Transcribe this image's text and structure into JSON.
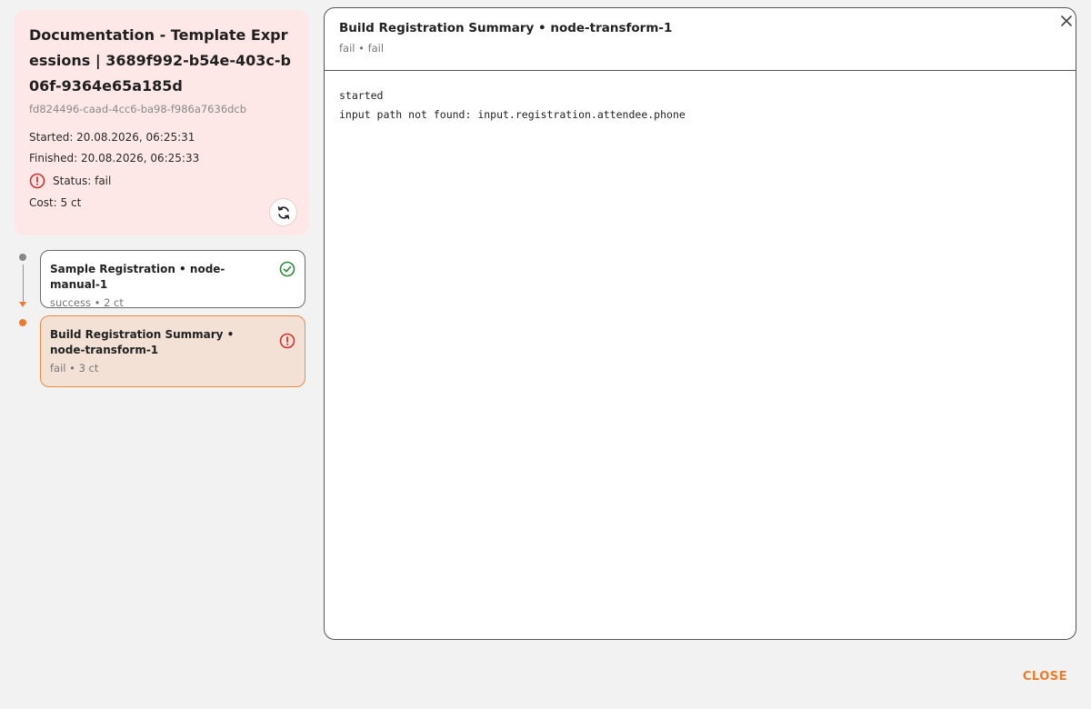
{
  "run": {
    "title": "Documentation - Template Expressions | 3689f992-b54e-403c-b06f-9364e65a185d",
    "id": "fd824496-caad-4cc6-ba98-f986a7636dcb",
    "started": "Started: 20.08.2026, 06:25:31",
    "finished": "Finished: 20.08.2026, 06:25:33",
    "status": "Status: fail",
    "cost": "Cost: 5 ct"
  },
  "nodes": [
    {
      "title": "Sample Registration • node-manual-1",
      "subtitle": "success • 2 ct",
      "status": "success"
    },
    {
      "title": "Build Registration Summary • node-transform-1",
      "subtitle": "fail • 3 ct",
      "status": "fail"
    }
  ],
  "log": {
    "title": "Build Registration Summary • node-transform-1",
    "subtitle": "fail • fail",
    "lines": [
      "started",
      "input path not found: input.registration.attendee.phone"
    ]
  },
  "footer": {
    "close_label": "CLOSE"
  },
  "colors": {
    "accent": "#ec7a2a",
    "success": "#2e8b3e",
    "error": "#d32f2f",
    "fail_bg": "#fde8e7"
  }
}
